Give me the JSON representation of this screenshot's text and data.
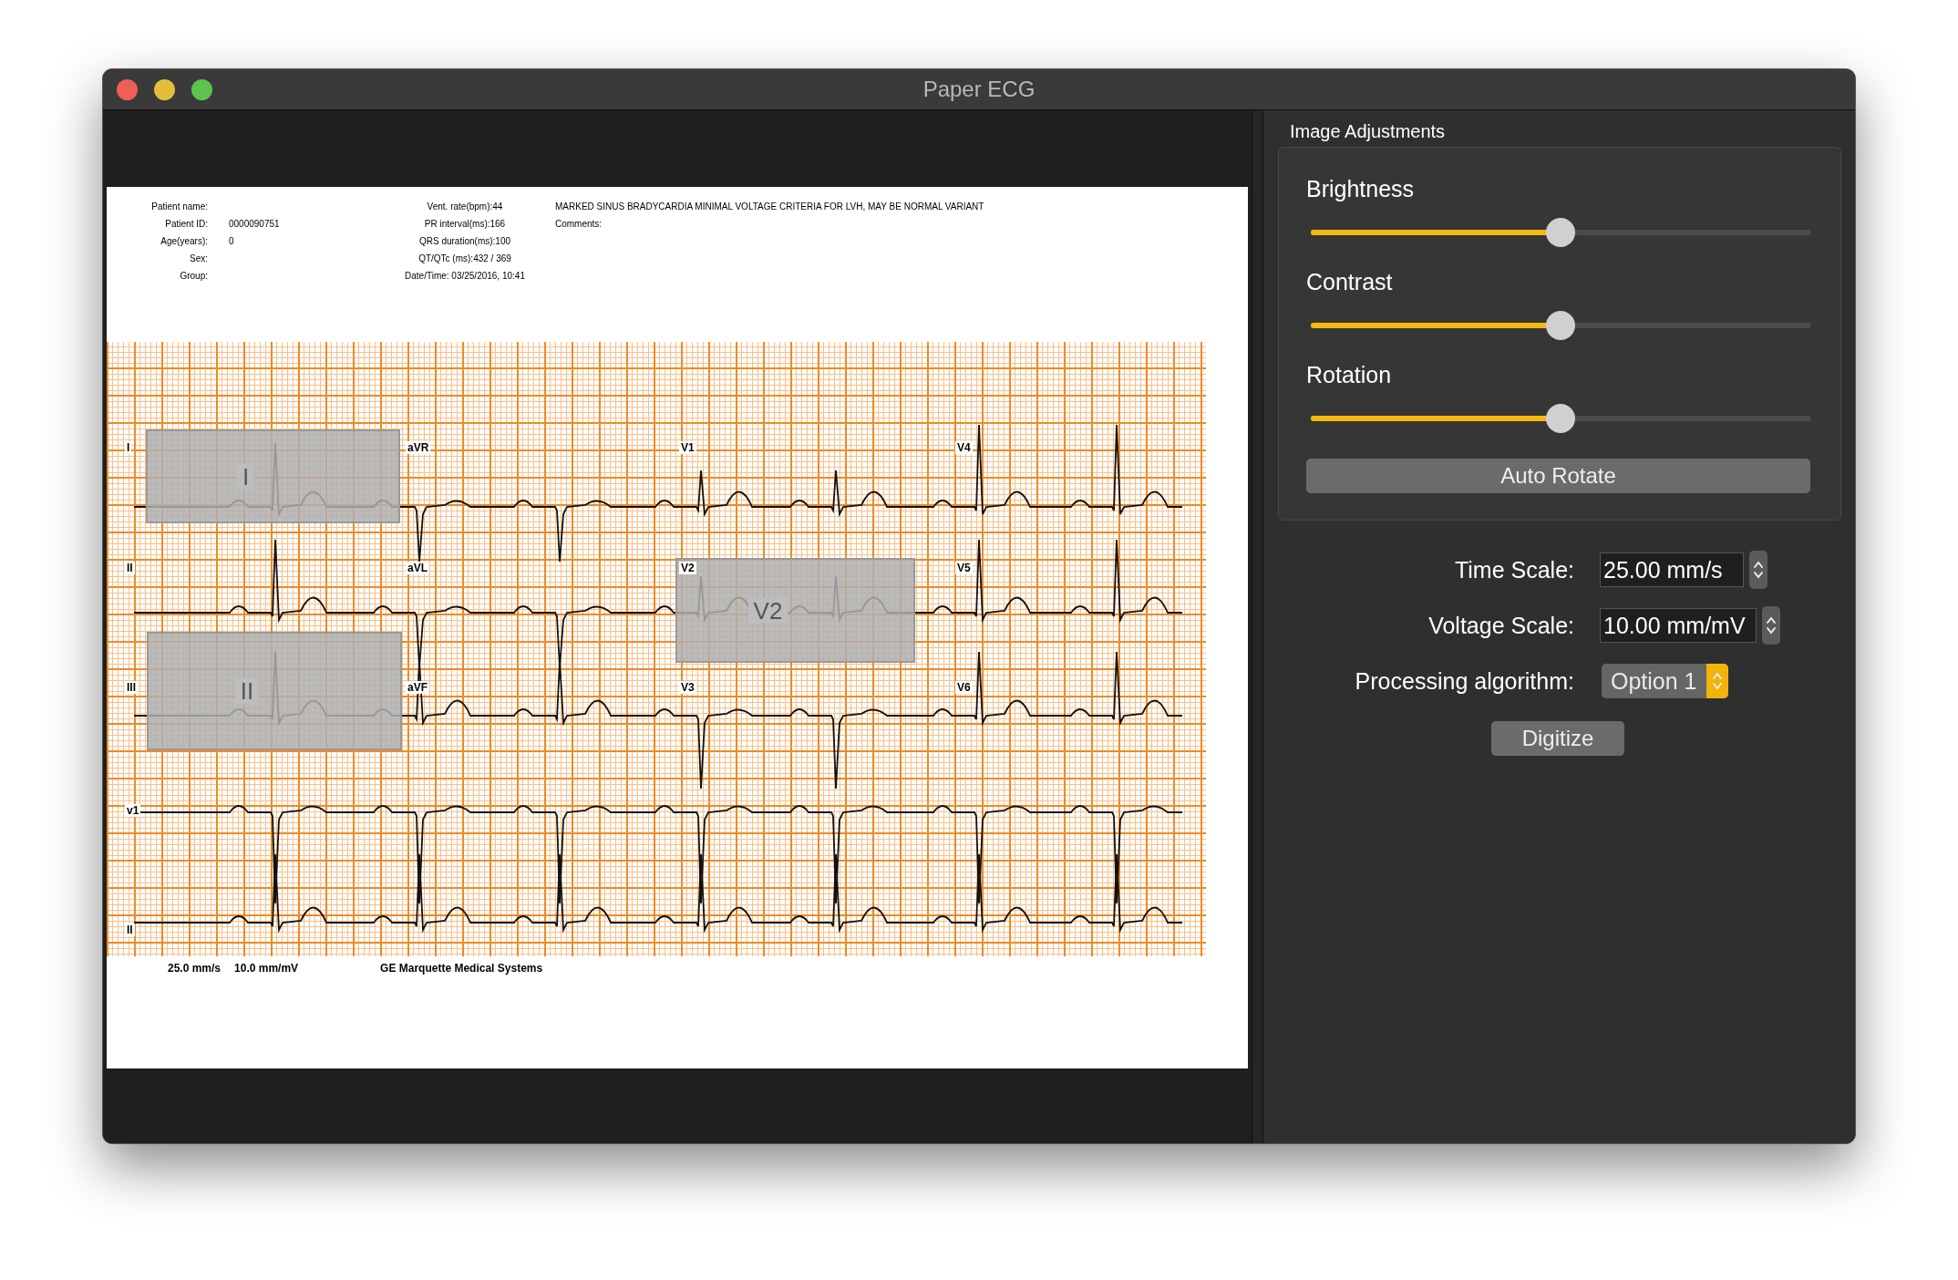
{
  "window": {
    "title": "Paper ECG"
  },
  "ecg_document": {
    "patient_fields": [
      {
        "label": "Patient name:"
      },
      {
        "label": "Patient ID:",
        "value": "0000090751"
      },
      {
        "label": "Age(years):",
        "value": "0"
      },
      {
        "label": "Sex:"
      },
      {
        "label": "Group:"
      }
    ],
    "measurements": [
      "Vent. rate(bpm):44",
      "PR interval(ms):166",
      "QRS duration(ms):100",
      "QT/QTc (ms):432 / 369",
      "Date/Time: 03/25/2016, 10:41"
    ],
    "interpretation": "MARKED SINUS BRADYCARDIA MINIMAL VOLTAGE CRITERIA FOR LVH, MAY BE NORMAL VARIANT",
    "comments_label": "Comments:",
    "lead_rows": [
      [
        "I",
        "aVR",
        "V1",
        "V4"
      ],
      [
        "II",
        "aVL",
        "V2",
        "V5"
      ],
      [
        "III",
        "aVF",
        "V3",
        "V6"
      ],
      [
        "v1"
      ],
      [
        "II"
      ]
    ],
    "lead_boxes": [
      {
        "label": "I"
      },
      {
        "label": "II"
      },
      {
        "label": "V2"
      }
    ],
    "footer": {
      "speed": "25.0 mm/s",
      "gain": "10.0 mm/mV",
      "device": "GE Marquette Medical Systems"
    }
  },
  "image_adjustments": {
    "title": "Image Adjustments",
    "sliders": [
      {
        "label": "Brightness",
        "level": 0.5
      },
      {
        "label": "Contrast",
        "level": 0.5
      },
      {
        "label": "Rotation",
        "level": 0.5
      }
    ],
    "button": "Auto Rotate"
  },
  "settings": [
    {
      "kind": "stepper",
      "label": "Time Scale:",
      "value": "25.00 mm/s"
    },
    {
      "kind": "stepper",
      "label": "Voltage Scale:",
      "value": "10.00 mm/mV"
    },
    {
      "kind": "popup",
      "label": "Processing algorithm:",
      "value": "Option 1"
    }
  ],
  "digitize_button": "Digitize"
}
